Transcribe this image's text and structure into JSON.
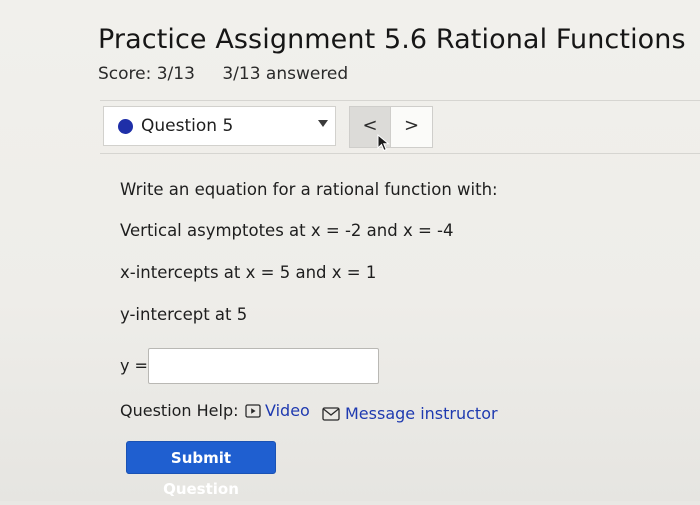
{
  "header": {
    "title": "Practice Assignment 5.6 Rational Functions",
    "score": "Score: 3/13",
    "answered": "3/13 answered"
  },
  "question_nav": {
    "selected": "Question 5",
    "prev_label": "<",
    "next_label": ">"
  },
  "question": {
    "prompt": "Write an equation for a rational function with:",
    "line1": "Vertical asymptotes at x = -2 and x = -4",
    "line2": "x-intercepts at x = 5 and x = 1",
    "line3": "y-intercept at 5"
  },
  "answer": {
    "label": "y =",
    "value": "",
    "placeholder": ""
  },
  "help": {
    "label": "Question Help:",
    "video_label": "Video",
    "message_label": "Message instructor"
  },
  "actions": {
    "submit_label": "Submit Question"
  },
  "colors": {
    "accent": "#1f5fd0",
    "link": "#1f3ab0",
    "status_dot": "#1f2fa8"
  },
  "icons": {
    "status": "filled-circle-icon",
    "dropdown": "caret-down-icon",
    "video": "play-box-icon",
    "message": "envelope-icon",
    "cursor": "mouse-pointer-icon"
  }
}
